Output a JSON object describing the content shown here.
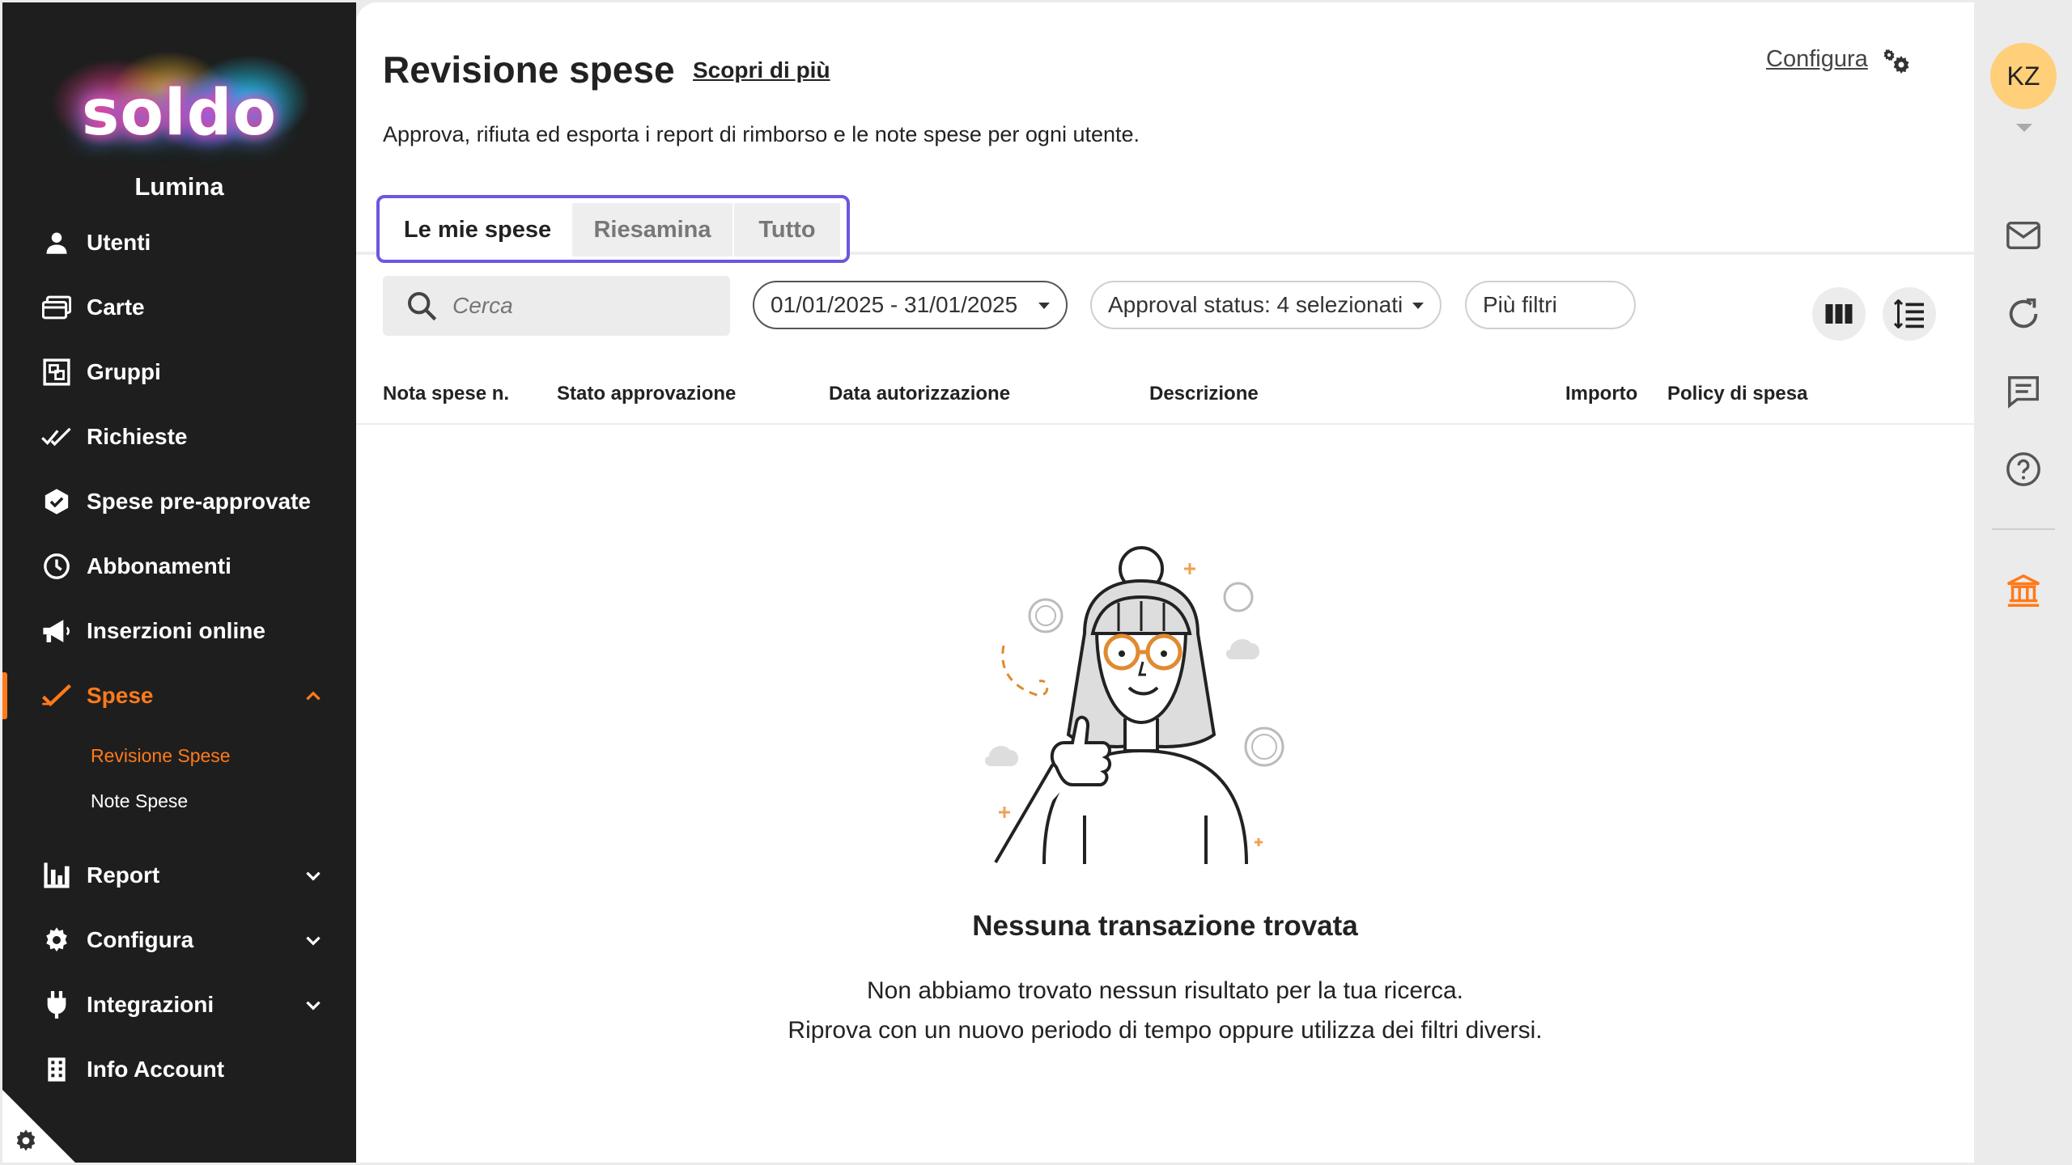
{
  "brand": {
    "logo_text": "soldo",
    "org_name": "Lumina",
    "accent": "#ff7a1a"
  },
  "sidebar": {
    "items": [
      {
        "label": "Utenti",
        "icon": "user-icon"
      },
      {
        "label": "Carte",
        "icon": "card-icon"
      },
      {
        "label": "Gruppi",
        "icon": "groups-icon"
      },
      {
        "label": "Richieste",
        "icon": "double-check-icon"
      },
      {
        "label": "Spese pre-approvate",
        "icon": "hexagon-check-icon"
      },
      {
        "label": "Abbonamenti",
        "icon": "clock-icon"
      },
      {
        "label": "Inserzioni online",
        "icon": "megaphone-icon"
      },
      {
        "label": "Spese",
        "icon": "check-icon",
        "active": true
      },
      {
        "label": "Report",
        "icon": "bar-chart-icon"
      },
      {
        "label": "Configura",
        "icon": "gear-icon"
      },
      {
        "label": "Integrazioni",
        "icon": "plug-icon"
      },
      {
        "label": "Info Account",
        "icon": "building-icon"
      }
    ],
    "sub_items": [
      {
        "label": "Revisione Spese",
        "active": true
      },
      {
        "label": "Note Spese",
        "active": false
      }
    ]
  },
  "header": {
    "title": "Revisione spese",
    "learn_more": "Scopri di più",
    "subtitle": "Approva, rifiuta ed esporta i report di rimborso e le note spese per ogni utente.",
    "configure": "Configura"
  },
  "tabs": [
    {
      "label": "Le mie spese",
      "selected": true
    },
    {
      "label": "Riesamina",
      "selected": false
    },
    {
      "label": "Tutto",
      "selected": false
    }
  ],
  "filters": {
    "search_placeholder": "Cerca",
    "date_range": "01/01/2025 - 31/01/2025",
    "approval_status": "Approval status: 4 selezionati",
    "more_filters": "Più filtri"
  },
  "table": {
    "columns": [
      "Nota spese n.",
      "Stato approvazione",
      "Data autorizzazione",
      "Descrizione",
      "Importo",
      "Policy di spesa"
    ]
  },
  "empty_state": {
    "title": "Nessuna transazione trovata",
    "line1": "Non abbiamo trovato nessun risultato per la tua ricerca.",
    "line2": "Riprova con un nuovo periodo di tempo oppure utilizza dei filtri diversi."
  },
  "rail": {
    "avatar_initials": "KZ",
    "avatar_color": "#ffcf7a",
    "icons": [
      "mail-icon",
      "refresh-icon",
      "chat-icon",
      "help-icon",
      "bank-icon"
    ]
  }
}
